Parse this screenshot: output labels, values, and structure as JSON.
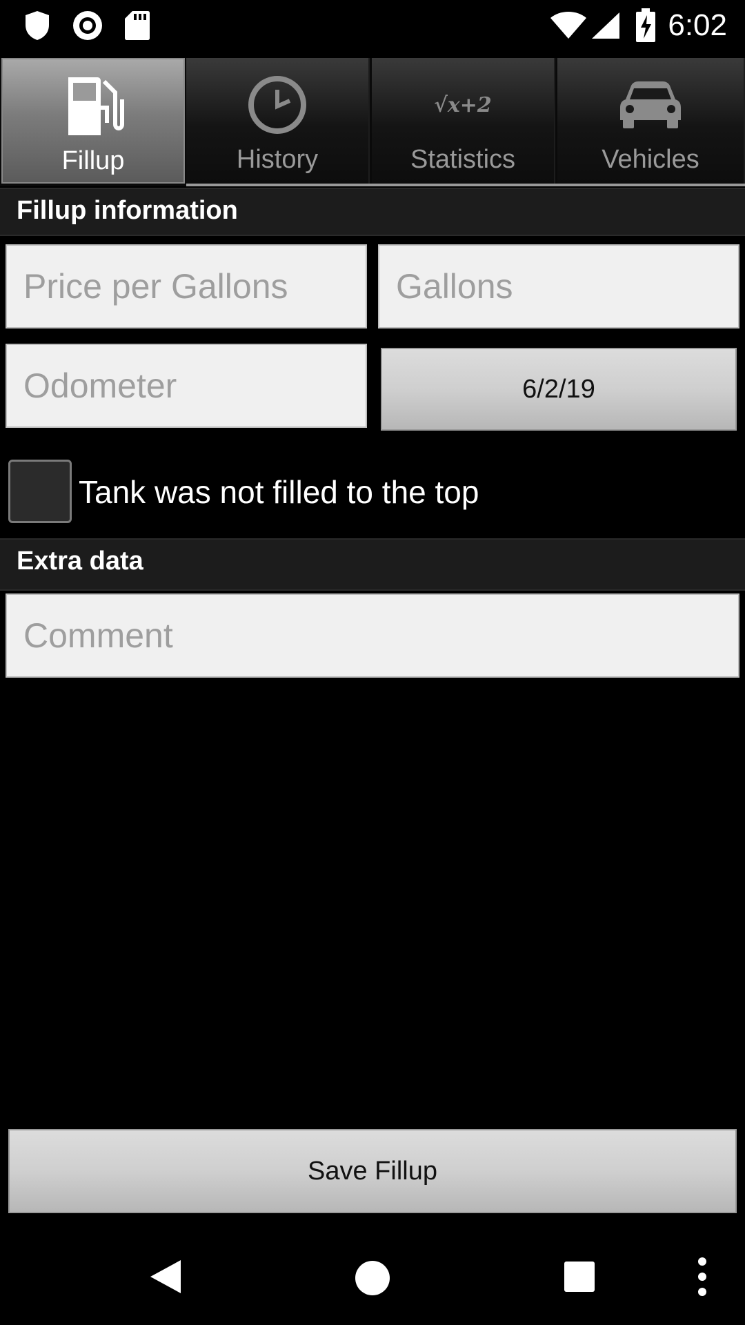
{
  "status_bar": {
    "time": "6:02",
    "left_icons": [
      "shield-icon",
      "record-icon",
      "sd-card-icon"
    ],
    "right_icons": [
      "wifi-icon",
      "signal-icon",
      "battery-charging-icon"
    ]
  },
  "tabs": [
    {
      "label": "Fillup",
      "icon": "fuel-pump-icon",
      "active": true
    },
    {
      "label": "History",
      "icon": "clock-icon",
      "active": false
    },
    {
      "label": "Statistics",
      "icon": "formula-icon",
      "icon_text": "√x+2",
      "active": false
    },
    {
      "label": "Vehicles",
      "icon": "car-icon",
      "active": false
    }
  ],
  "fillup_section": {
    "title": "Fillup information",
    "price_placeholder": "Price per Gallons",
    "price_value": "",
    "gallons_placeholder": "Gallons",
    "gallons_value": "",
    "odometer_placeholder": "Odometer",
    "odometer_value": "",
    "date_button": "6/2/19",
    "partial_fill_label": "Tank was not filled to the top",
    "partial_fill_checked": false
  },
  "extra_section": {
    "title": "Extra data",
    "comment_placeholder": "Comment",
    "comment_value": ""
  },
  "save_button": "Save Fillup",
  "nav_bar": [
    "back-icon",
    "home-icon",
    "recents-icon",
    "overflow-menu-icon"
  ],
  "colors": {
    "background": "#000000",
    "header_bg": "#1c1c1c",
    "field_bg": "#f0f0f0",
    "placeholder": "#9e9e9e"
  }
}
